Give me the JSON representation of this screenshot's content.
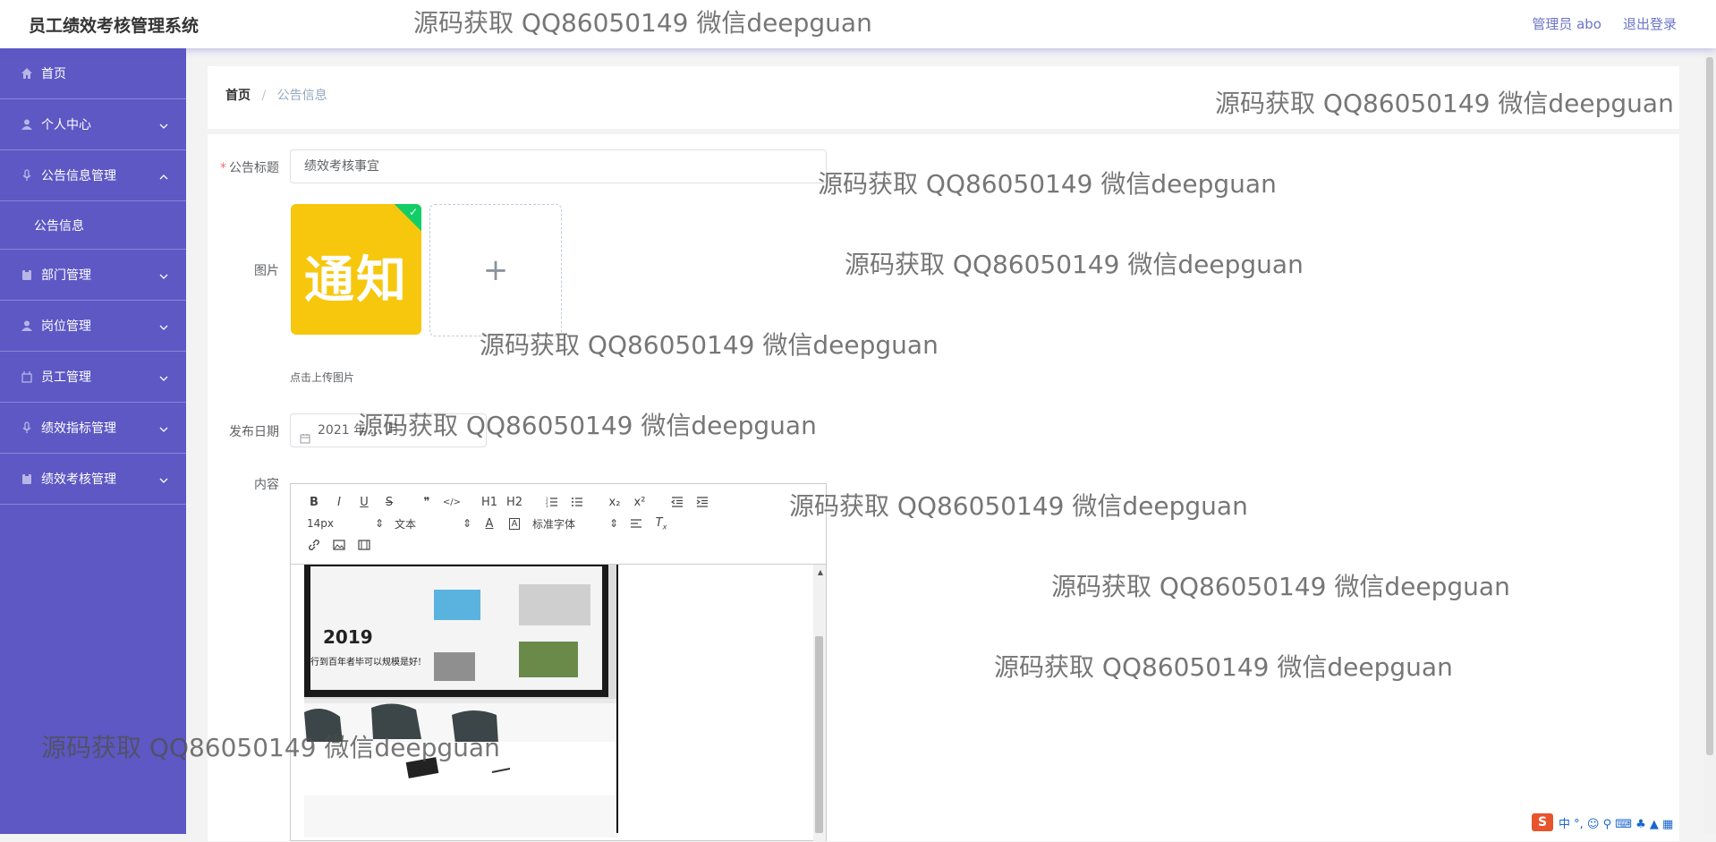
{
  "header": {
    "app_title": "员工绩效考核管理系统",
    "user_label": "管理员 abo",
    "logout_label": "退出登录"
  },
  "sidebar": {
    "items": [
      {
        "label": "首页",
        "icon": "home-icon"
      },
      {
        "label": "个人中心",
        "icon": "user-icon"
      },
      {
        "label": "公告信息管理",
        "icon": "mic-icon"
      },
      {
        "label": "公告信息",
        "icon": ""
      },
      {
        "label": "部门管理",
        "icon": "clipboard-icon"
      },
      {
        "label": "岗位管理",
        "icon": "user-icon"
      },
      {
        "label": "员工管理",
        "icon": "frame-icon"
      },
      {
        "label": "绩效指标管理",
        "icon": "mic-icon"
      },
      {
        "label": "绩效考核管理",
        "icon": "clipboard-icon"
      }
    ]
  },
  "breadcrumb": {
    "home": "首页",
    "separator": "/",
    "current": "公告信息"
  },
  "form": {
    "title_label": "公告标题",
    "title_value": "绩效考核事宜",
    "image_label": "图片",
    "image_text": "通知",
    "upload_plus": "+",
    "upload_tip": "点击上传图片",
    "date_label": "发布日期",
    "date_value": "2021 年 … 月",
    "content_label": "内容"
  },
  "editor": {
    "toolbar_row1": [
      "B",
      "I",
      "U",
      "S",
      "❞",
      "</>",
      "H1",
      "H2",
      "ol",
      "ul",
      "x₂",
      "x²",
      "outdent",
      "indent"
    ],
    "font_size": "14px",
    "heading": "文本",
    "font_family": "标准字体",
    "photo_year": "2019",
    "photo_slogan": "行到百年者毕可以规模是好!"
  },
  "watermark": "源码获取 QQ86050149 微信deepguan",
  "ime": {
    "logo": "S",
    "text": "中 °, ☺ ⚲ ⌨ ♣ ▲ ▦"
  },
  "colors": {
    "sidebar": "#5d58c4",
    "accent": "#6b74c9",
    "notice_bg": "#f6c70c",
    "success": "#13ce66"
  }
}
